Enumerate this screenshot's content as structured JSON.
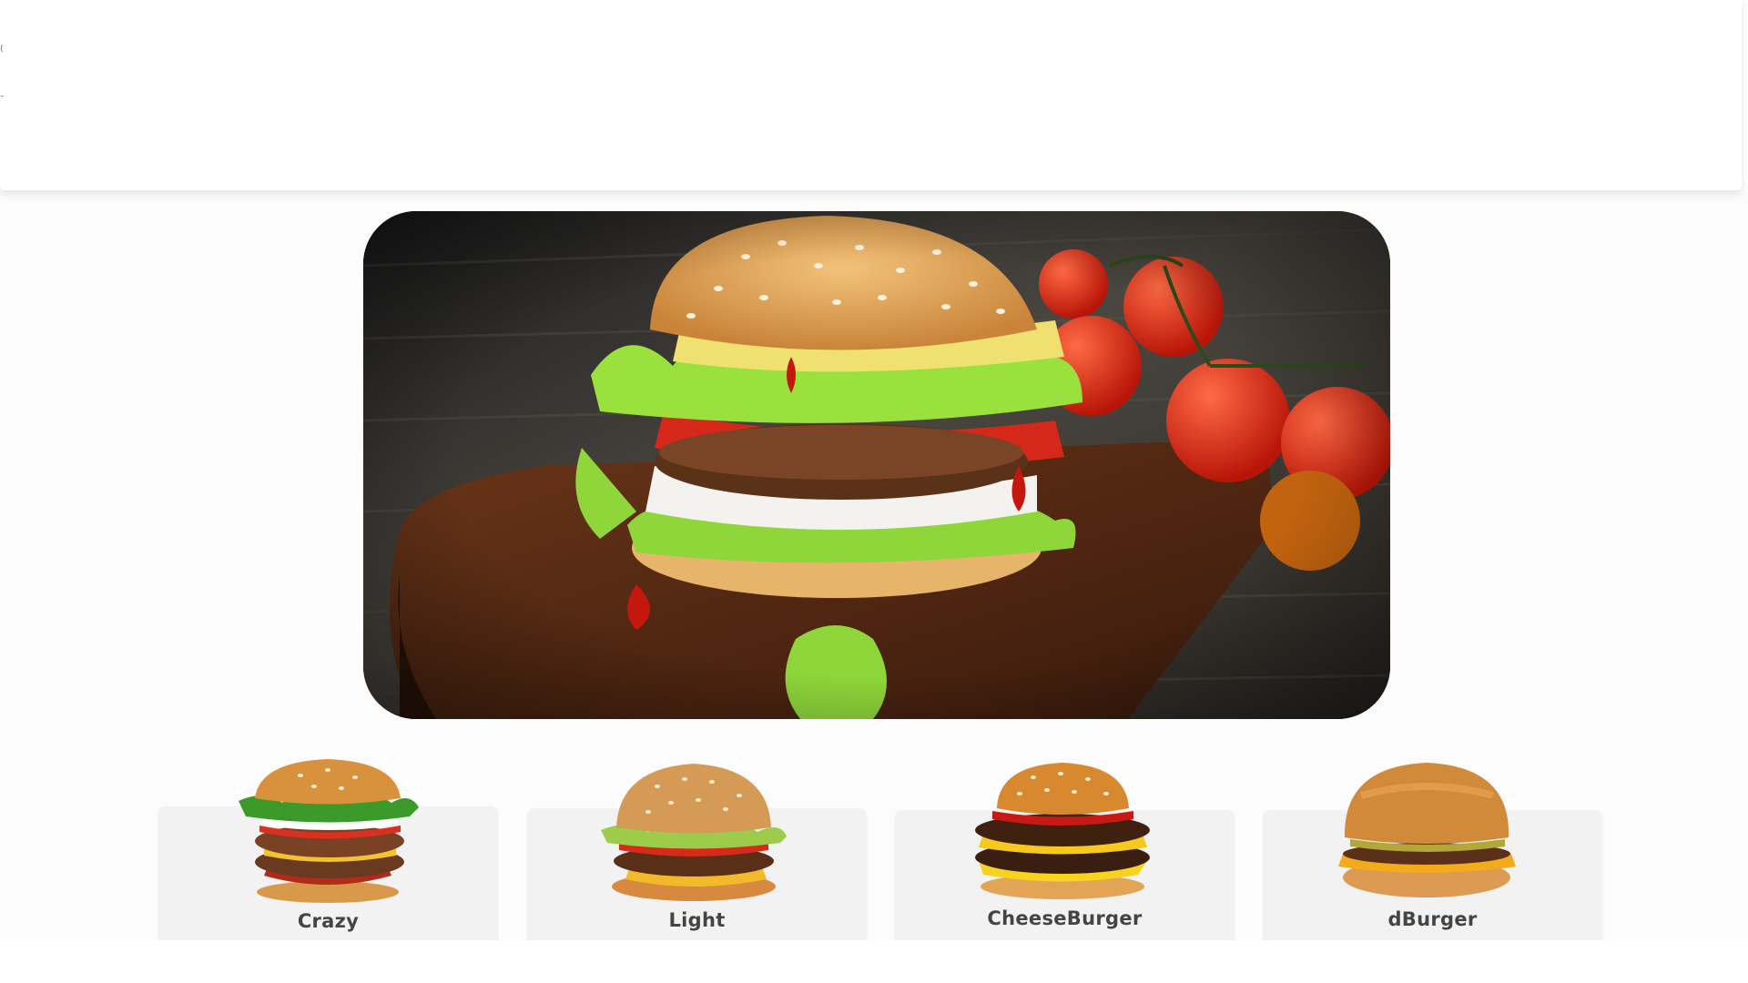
{
  "header": {
    "edge_marks": [
      "⟨",
      "–",
      "–"
    ]
  },
  "hero": {
    "image": "burger-on-wooden-board-with-tomatoes"
  },
  "menu": {
    "items": [
      {
        "label": "Crazy",
        "image": "crazy-burger-image"
      },
      {
        "label": "Light",
        "image": "light-burger-image"
      },
      {
        "label": "CheeseBurger",
        "image": "cheeseburger-image"
      },
      {
        "label": "dBurger",
        "image": "dburger-image"
      }
    ]
  },
  "colors": {
    "card_bg": "#f2f2f2",
    "label_text": "#444444",
    "page_bg": "#fcfcfc"
  }
}
